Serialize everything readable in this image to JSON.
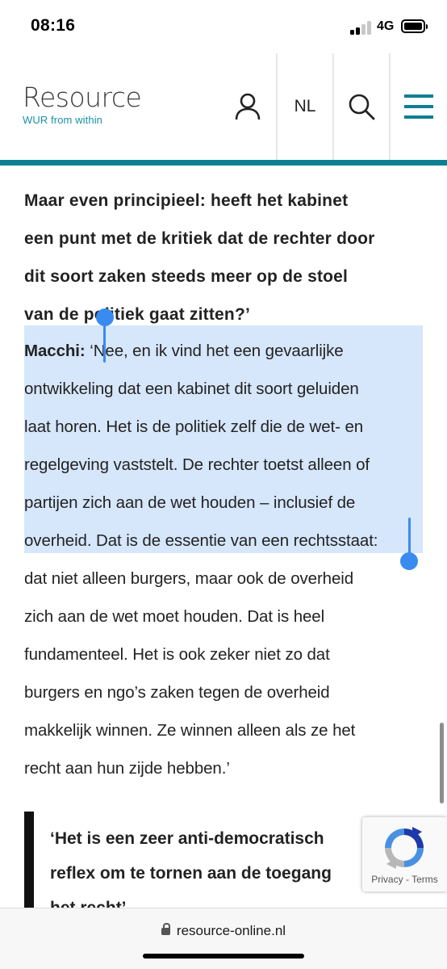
{
  "status_bar": {
    "time": "08:16",
    "network": "4G"
  },
  "header": {
    "logo_word": "Resource",
    "logo_tagline": "WUR from within",
    "lang_button": "NL",
    "icons": {
      "account": "user-icon",
      "search": "search-icon",
      "menu": "hamburger-menu-icon"
    },
    "accent_color": "#0e7f93"
  },
  "article": {
    "question_lines": [
      "Maar even principieel: heeft het kabinet",
      "een punt met de kritiek dat de rechter door",
      "dit soort zaken steeds meer op de stoel",
      "van de politiek gaat zitten?’"
    ],
    "speaker": "Macchi:",
    "answer_first_line": "‘Nee, en ik vind het een gevaarlijke",
    "answer_lines": [
      "ontwikkeling dat een kabinet dit soort geluiden",
      "laat horen. Het is de politiek zelf die de wet- en",
      "regelgeving vaststelt. De rechter toetst alleen of",
      "partijen zich aan de wet houden – inclusief de",
      "overheid. Dat is de essentie van een rechtsstaat:",
      "dat niet alleen burgers, maar ook de overheid",
      "zich aan de wet moet houden. Dat is heel",
      "fundamenteel. Het is ook zeker niet zo dat",
      "burgers en ngo’s zaken tegen de overheid",
      "makkelijk winnen. Ze winnen alleen als ze het",
      "recht aan hun zijde hebben.’"
    ],
    "pull_quote_lines": [
      "‘Het is een zeer anti-democratisch",
      "reflex om te tornen aan de toegang",
      "het recht’"
    ],
    "selection_color": "#d6e6fb"
  },
  "recaptcha": {
    "privacy": "Privacy",
    "separator": " - ",
    "terms": "Terms"
  },
  "browser": {
    "url": "resource-online.nl"
  }
}
